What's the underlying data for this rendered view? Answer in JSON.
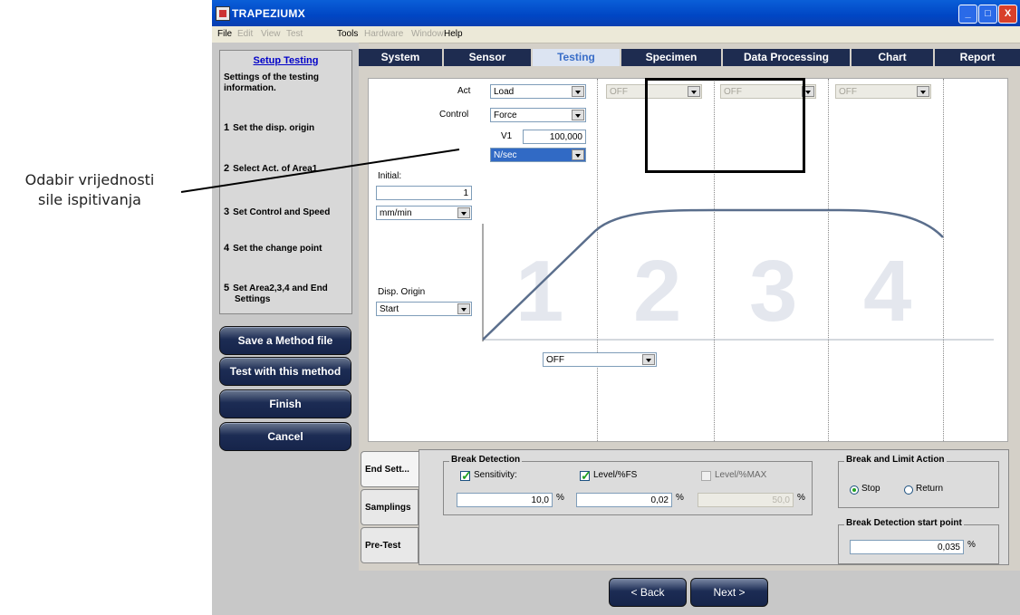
{
  "annotation": {
    "line1": "Odabir vrijednosti",
    "line2": "sile ispitivanja"
  },
  "window": {
    "title": "TRAPEZIUMX",
    "min": "_",
    "max": "□",
    "close": "X"
  },
  "menu": [
    {
      "label": "File",
      "enabled": true
    },
    {
      "label": "Edit",
      "enabled": false
    },
    {
      "label": "View",
      "enabled": false
    },
    {
      "label": "Test",
      "enabled": false
    },
    {
      "label": "Tools",
      "enabled": true
    },
    {
      "label": "Hardware",
      "enabled": false
    },
    {
      "label": "Window",
      "enabled": false
    },
    {
      "label": "Help",
      "enabled": true
    }
  ],
  "sidebar": {
    "title": "Setup Testing",
    "desc": "Settings of the testing information.",
    "steps": [
      {
        "num": "1",
        "label": "Set the disp. origin"
      },
      {
        "num": "2",
        "label": "Select Act. of Area1"
      },
      {
        "num": "3",
        "label": "Set Control and Speed"
      },
      {
        "num": "4",
        "label": "Set the change point"
      },
      {
        "num": "5",
        "label": "Set Area2,3,4 and End Settings"
      }
    ],
    "buttons": {
      "save": "Save a Method file",
      "test": "Test with this method",
      "finish": "Finish",
      "cancel": "Cancel"
    }
  },
  "tabs": [
    "System",
    "Sensor",
    "Testing",
    "Specimen",
    "Data Processing",
    "Chart",
    "Report"
  ],
  "testing": {
    "act_label": "Act",
    "act_value": "Load",
    "control_label": "Control",
    "control_value": "Force",
    "v1_label": "V1",
    "v1_value": "100,000",
    "unit_value": "N/sec",
    "area_off": [
      "OFF",
      "OFF",
      "OFF"
    ],
    "initial_label": "Initial:",
    "initial_value": "1",
    "initial_unit": "mm/min",
    "disp_origin_label": "Disp. Origin",
    "disp_origin_value": "Start",
    "change_point": "OFF",
    "area_numbers": [
      "1",
      "2",
      "3",
      "4"
    ]
  },
  "bottom": {
    "tabs": [
      "End Sett...",
      "Samplings",
      "Pre-Test"
    ],
    "break_detection": {
      "title": "Break Detection",
      "sensitivity_label": "Sensitivity:",
      "sensitivity_checked": true,
      "sensitivity_value": "10,0",
      "level_fs_label": "Level/%FS",
      "level_fs_checked": true,
      "level_fs_value": "0,02",
      "level_max_label": "Level/%MAX",
      "level_max_checked": false,
      "level_max_value": "50,0",
      "pct": "%"
    },
    "break_limit": {
      "title": "Break and Limit Action",
      "stop": "Stop",
      "return": "Return",
      "selected": "Stop"
    },
    "break_start": {
      "title": "Break Detection start point",
      "value": "0,035",
      "pct": "%"
    }
  },
  "nav": {
    "back": "< Back",
    "next": "Next >"
  },
  "colors": {
    "title_bar": "#0046c4",
    "tab_dark": "#1e2c50",
    "accent_blue": "#316ac5",
    "curve": "#5a6e8c"
  }
}
